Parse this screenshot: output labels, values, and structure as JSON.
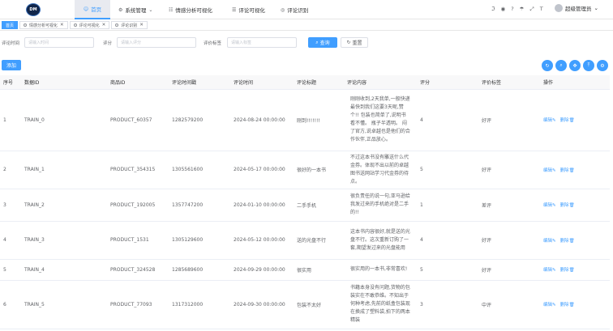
{
  "topbar": {
    "logo_text": "DM",
    "nav": [
      {
        "icon": "☺",
        "label": "首页",
        "active": true
      },
      {
        "icon": "⚙",
        "label": "系统管理",
        "caret": "⌄"
      },
      {
        "icon": "☷",
        "label": "情感分析可视化"
      },
      {
        "icon": "☰",
        "label": "评论可视化"
      },
      {
        "icon": "◎",
        "label": "评论识别"
      }
    ],
    "user_name": "超级管理员",
    "user_caret": "⌄"
  },
  "tabs": [
    {
      "label": "首页",
      "active": true
    },
    {
      "label": "情感分析可视化",
      "close": "✕"
    },
    {
      "label": "评论可视化",
      "close": "✕"
    },
    {
      "label": "评论识别",
      "close": "✕"
    }
  ],
  "filter": {
    "label_time": "评论时间",
    "placeholder_time": "请输入时间",
    "label_score": "评分",
    "placeholder_score": "请输入评分",
    "label_tag": "评价标签",
    "placeholder_tag": "请输入标签",
    "search_label": "查询",
    "reset_label": "重置"
  },
  "toolbar": {
    "add_label": "添加"
  },
  "table": {
    "headers": [
      "序号",
      "数据ID",
      "商品ID",
      "评论时间戳",
      "评论时间",
      "评论标题",
      "评论内容",
      "评分",
      "评价标签",
      "操作"
    ],
    "edit_label": "编辑",
    "delete_label": "删除",
    "rows": [
      {
        "seq": "1",
        "data_id": "TRAIN_0",
        "product_id": "PRODUCT_60357",
        "timestamp": "1282579200",
        "time": "2024-08-24 00:00:00",
        "title": "刚到!!!!!!!",
        "content": "刚刚收到,2天我单,一般快递最快到我们这要3天呢,赞个!! 包装也简单了,说明书看不懂。 瓶子半透明。 闷了官方,说卓越也是他们的合作伙伴,正品放心。",
        "score": "4",
        "tag": "好评"
      },
      {
        "seq": "2",
        "data_id": "TRAIN_1",
        "product_id": "PRODUCT_354315",
        "timestamp": "1305561600",
        "time": "2024-05-17 00:00:00",
        "title": "很好的一本书",
        "content": "不过这本书没有雕送什么代金券。体现不出以前的卓越图书送网站学习代金券的待点。",
        "score": "5",
        "tag": "好评"
      },
      {
        "seq": "3",
        "data_id": "TRAIN_2",
        "product_id": "PRODUCT_192005",
        "timestamp": "1357747200",
        "time": "2024-01-10 00:00:00",
        "title": "二手手机",
        "content": "很负责任的说一句,亚马逊给我发过来的手机绝对是二手的!!",
        "score": "1",
        "tag": "差评"
      },
      {
        "seq": "4",
        "data_id": "TRAIN_3",
        "product_id": "PRODUCT_1531",
        "timestamp": "1305129600",
        "time": "2024-05-12 00:00:00",
        "title": "送的光盘不行",
        "content": "这本书内容很好,就是送的光盘不行。这次重新订购了一套,期望发过来的光盘能用",
        "score": "4",
        "tag": "好评"
      },
      {
        "seq": "5",
        "data_id": "TRAIN_4",
        "product_id": "PRODUCT_324528",
        "timestamp": "1285689600",
        "time": "2024-09-29 00:00:00",
        "title": "很实用",
        "content": "很实用的一本书,非常喜欢!",
        "score": "5",
        "tag": "好评"
      },
      {
        "seq": "6",
        "data_id": "TRAIN_5",
        "product_id": "PRODUCT_77093",
        "timestamp": "1317312000",
        "time": "2024-09-30 00:00:00",
        "title": "包装不太好",
        "content": "书籍本身没有问题,货物的包装实在不敢恭维。不知出于何种考虑,先前的纸盒包装现在换成了塑料袋,拍下的两本精装",
        "score": "3",
        "tag": "中评"
      }
    ]
  }
}
